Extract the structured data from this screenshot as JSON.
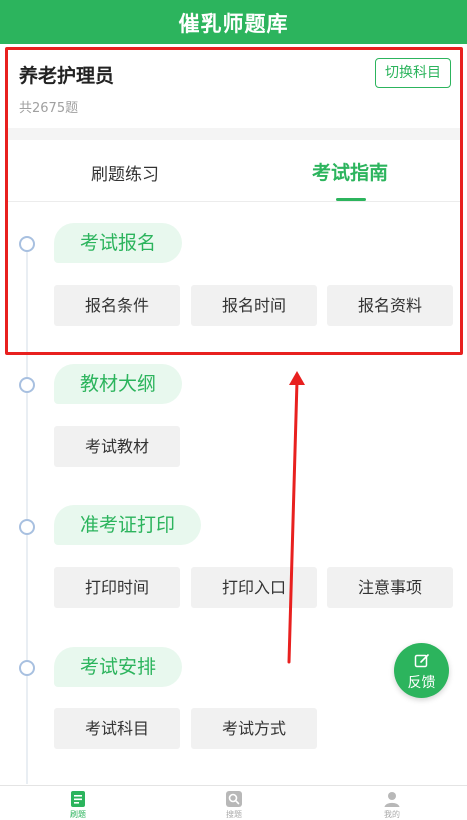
{
  "header": {
    "title": "催乳师题库"
  },
  "subject": {
    "name": "养老护理员",
    "count_text": "共2675题",
    "switch_label": "切换科目"
  },
  "tabs": [
    {
      "label": "刷题练习",
      "active": false
    },
    {
      "label": "考试指南",
      "active": true
    }
  ],
  "sections": [
    {
      "title": "考试报名",
      "items": [
        "报名条件",
        "报名时间",
        "报名资料"
      ]
    },
    {
      "title": "教材大纲",
      "items": [
        "考试教材"
      ]
    },
    {
      "title": "准考证打印",
      "items": [
        "打印时间",
        "打印入口",
        "注意事项"
      ]
    },
    {
      "title": "考试安排",
      "items": [
        "考试科目",
        "考试方式"
      ]
    }
  ],
  "feedback": {
    "label": "反馈",
    "icon": "edit-icon"
  },
  "bottom_nav": [
    {
      "label": "刷题",
      "icon": "document-icon",
      "active": true
    },
    {
      "label": "搜题",
      "icon": "search-icon",
      "active": false
    },
    {
      "label": "我的",
      "icon": "user-icon",
      "active": false
    }
  ],
  "colors": {
    "brand": "#2cb45d",
    "annotation": "#e8201f"
  }
}
